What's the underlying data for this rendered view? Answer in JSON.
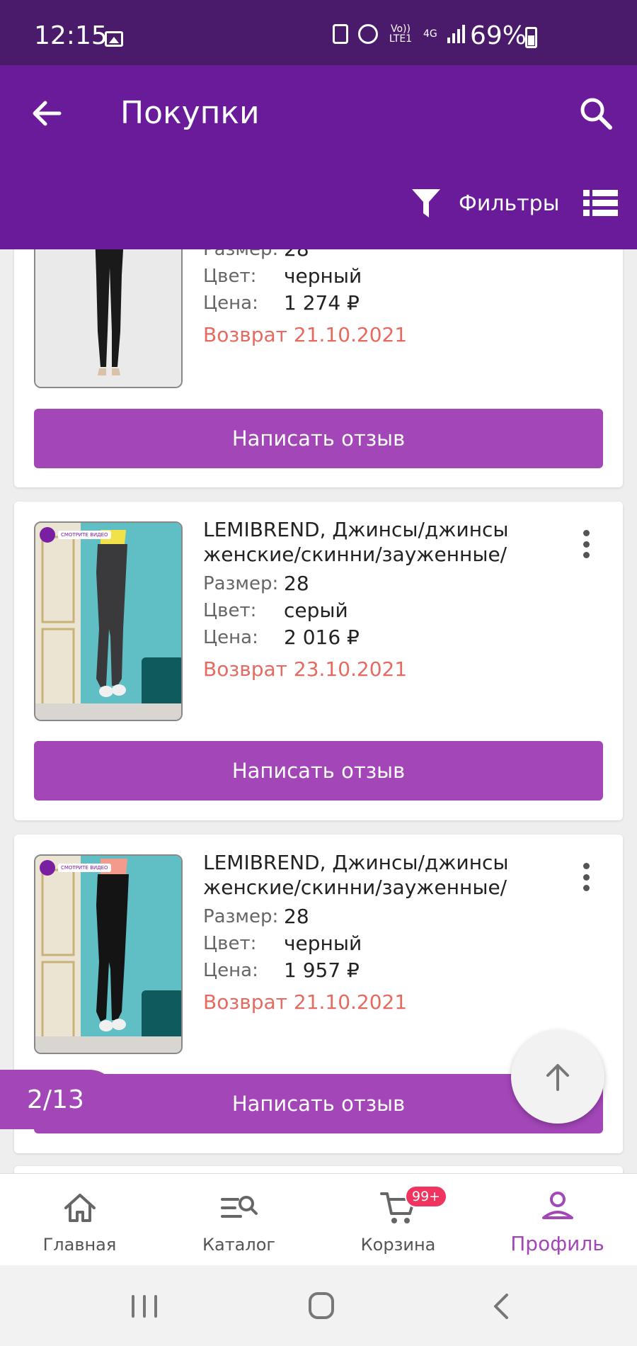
{
  "status_bar": {
    "time": "12:15",
    "network": "4G",
    "volte": "Vo)) LTE1",
    "battery": "69%"
  },
  "header": {
    "title": "Покупки",
    "filters_label": "Фильтры"
  },
  "products": [
    {
      "title": "",
      "size_label": "Размер:",
      "size": "28",
      "color_label": "Цвет:",
      "color": "черный",
      "price_label": "Цена:",
      "price": "1 274 ₽",
      "return_text": "Возврат 21.10.2021",
      "review_label": "Написать отзыв"
    },
    {
      "title": "LEMIBREND, Джинсы/джинсы женские/скинни/зауженные/",
      "video_badge": "СМОТРИТЕ ВИДЕО",
      "size_label": "Размер:",
      "size": "28",
      "color_label": "Цвет:",
      "color": "серый",
      "price_label": "Цена:",
      "price": "2 016 ₽",
      "return_text": "Возврат 23.10.2021",
      "review_label": "Написать отзыв"
    },
    {
      "title": "LEMIBREND, Джинсы/джинсы женские/скинни/зауженные/",
      "video_badge": "СМОТРИТЕ ВИДЕО",
      "size_label": "Размер:",
      "size": "28",
      "color_label": "Цвет:",
      "color": "черный",
      "price_label": "Цена:",
      "price": "1 957 ₽",
      "return_text": "Возврат 21.10.2021",
      "review_label": "Написать отзыв"
    }
  ],
  "pager": {
    "counter": "2/13"
  },
  "bottom_nav": {
    "items": [
      {
        "label": "Главная",
        "icon": "home-icon"
      },
      {
        "label": "Каталог",
        "icon": "catalog-search-icon"
      },
      {
        "label": "Корзина",
        "icon": "cart-icon",
        "badge": "99+"
      },
      {
        "label": "Профиль",
        "icon": "profile-icon",
        "active": true
      }
    ]
  },
  "colors": {
    "status_bar": "#4a1a6b",
    "header": "#6a1b9a",
    "accent": "#a346b8",
    "return_text": "#e56a60",
    "badge": "#f0335f"
  }
}
